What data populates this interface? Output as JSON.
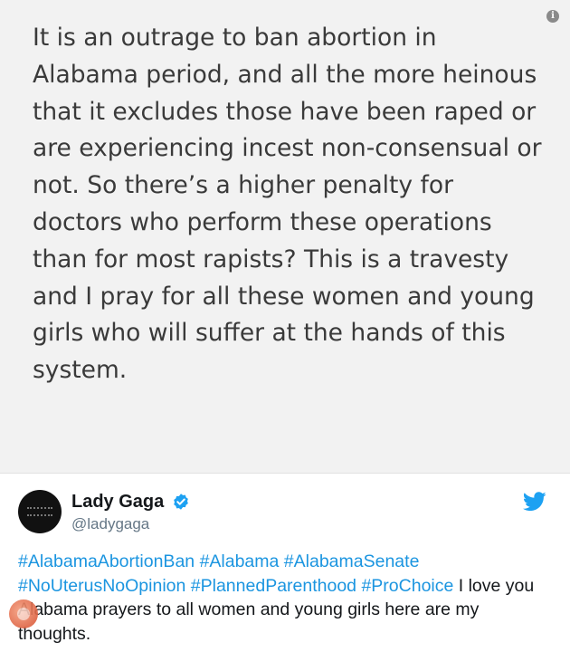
{
  "note": {
    "text": "It is an outrage to ban abortion in\nAlabama period, and all the more heinous\nthat it excludes those have been raped or\nare experiencing incest non-consensual or\nnot. So there’s a higher penalty for\ndoctors who perform these operations\nthan for most rapists? This is a travesty\nand I pray for all these women and young\ngirls who will suffer at the hands of this\nsystem."
  },
  "tweet": {
    "display_name": "Lady Gaga",
    "handle": "@ladygaga",
    "verified": true,
    "hashtags": [
      "#AlabamaAbortionBan",
      "#Alabama",
      "#AlabamaSenate",
      "#NoUterusNoOpinion",
      "#PlannedParenthood",
      "#ProChoice"
    ],
    "text_after_hashtags": "I love you Alabama prayers to all women and young girls here are my thoughts."
  },
  "colors": {
    "hashtag": "#1b95e0",
    "verified": "#1da1f2",
    "twitter_bird": "#1da1f2"
  },
  "icons": {
    "info": "info-icon",
    "verified": "verified-badge-icon",
    "twitter": "twitter-bird-icon",
    "watermark": "watermark-logo"
  }
}
